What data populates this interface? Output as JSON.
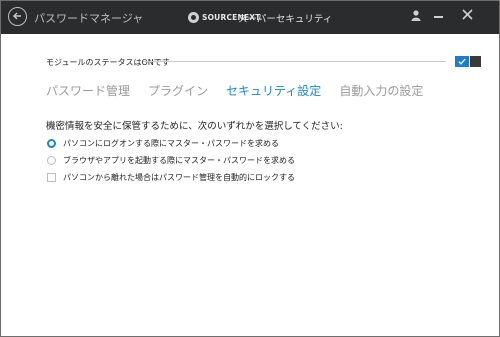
{
  "titlebar": {
    "app_title": "パスワードマネージャ",
    "brand": "SOURCENEXT.",
    "product": "スーパーセキュリティ"
  },
  "module": {
    "status_label": "モジュールのステータスはONです",
    "enabled": true
  },
  "tabs": [
    {
      "label": "パスワード管理",
      "active": false
    },
    {
      "label": "プラグイン",
      "active": false
    },
    {
      "label": "セキュリティ設定",
      "active": true
    },
    {
      "label": "自動入力の設定",
      "active": false
    }
  ],
  "security": {
    "instruction": "機密情報を安全に保管するために、次のいずれかを選択してください:",
    "options": [
      {
        "label": "パソコンにログオンする際にマスター・パスワードを求める",
        "type": "radio",
        "checked": true
      },
      {
        "label": "ブラウザやアプリを起動する際にマスター・パスワードを求める",
        "type": "radio",
        "checked": false
      },
      {
        "label": "パソコンから離れた場合はパスワード管理を自動的にロックする",
        "type": "checkbox",
        "checked": false
      }
    ]
  },
  "colors": {
    "titlebar_bg": "#2b2c2e",
    "accent": "#1a86d1"
  }
}
